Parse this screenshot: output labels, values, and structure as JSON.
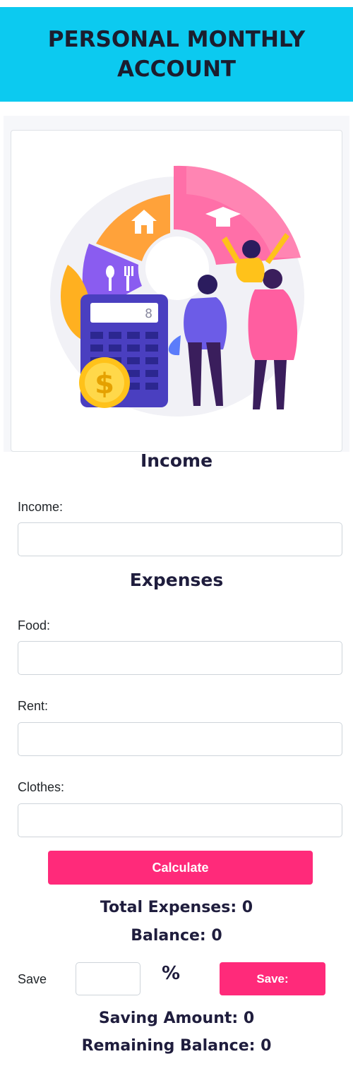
{
  "header": {
    "title": "PERSONAL MONTHLY ACCOUNT"
  },
  "hero": {
    "image_name": "budget-illustration",
    "calculator_display": "8",
    "coin_symbol": "$"
  },
  "income": {
    "section_title": "Income",
    "label": "Income:",
    "value": ""
  },
  "expenses": {
    "section_title": "Expenses",
    "food_label": "Food:",
    "food_value": "",
    "rent_label": "Rent:",
    "rent_value": "",
    "clothes_label": "Clothes:",
    "clothes_value": ""
  },
  "calculate_button": "Calculate",
  "totals": {
    "total_expenses_label": "Total Expenses:",
    "total_expenses_value": "0",
    "balance_label": "Balance:",
    "balance_value": "0"
  },
  "saving": {
    "save_label": "Save",
    "percent_value": "",
    "percent_symbol": "%",
    "save_button": "Save:",
    "saving_amount_label": "Saving Amount:",
    "saving_amount_value": "0",
    "remaining_balance_label": "Remaining Balance:",
    "remaining_balance_value": "0"
  },
  "colors": {
    "header_bg": "#0ccaf0",
    "button_pink": "#ff2a7a",
    "heading_navy": "#1f1d3d"
  }
}
